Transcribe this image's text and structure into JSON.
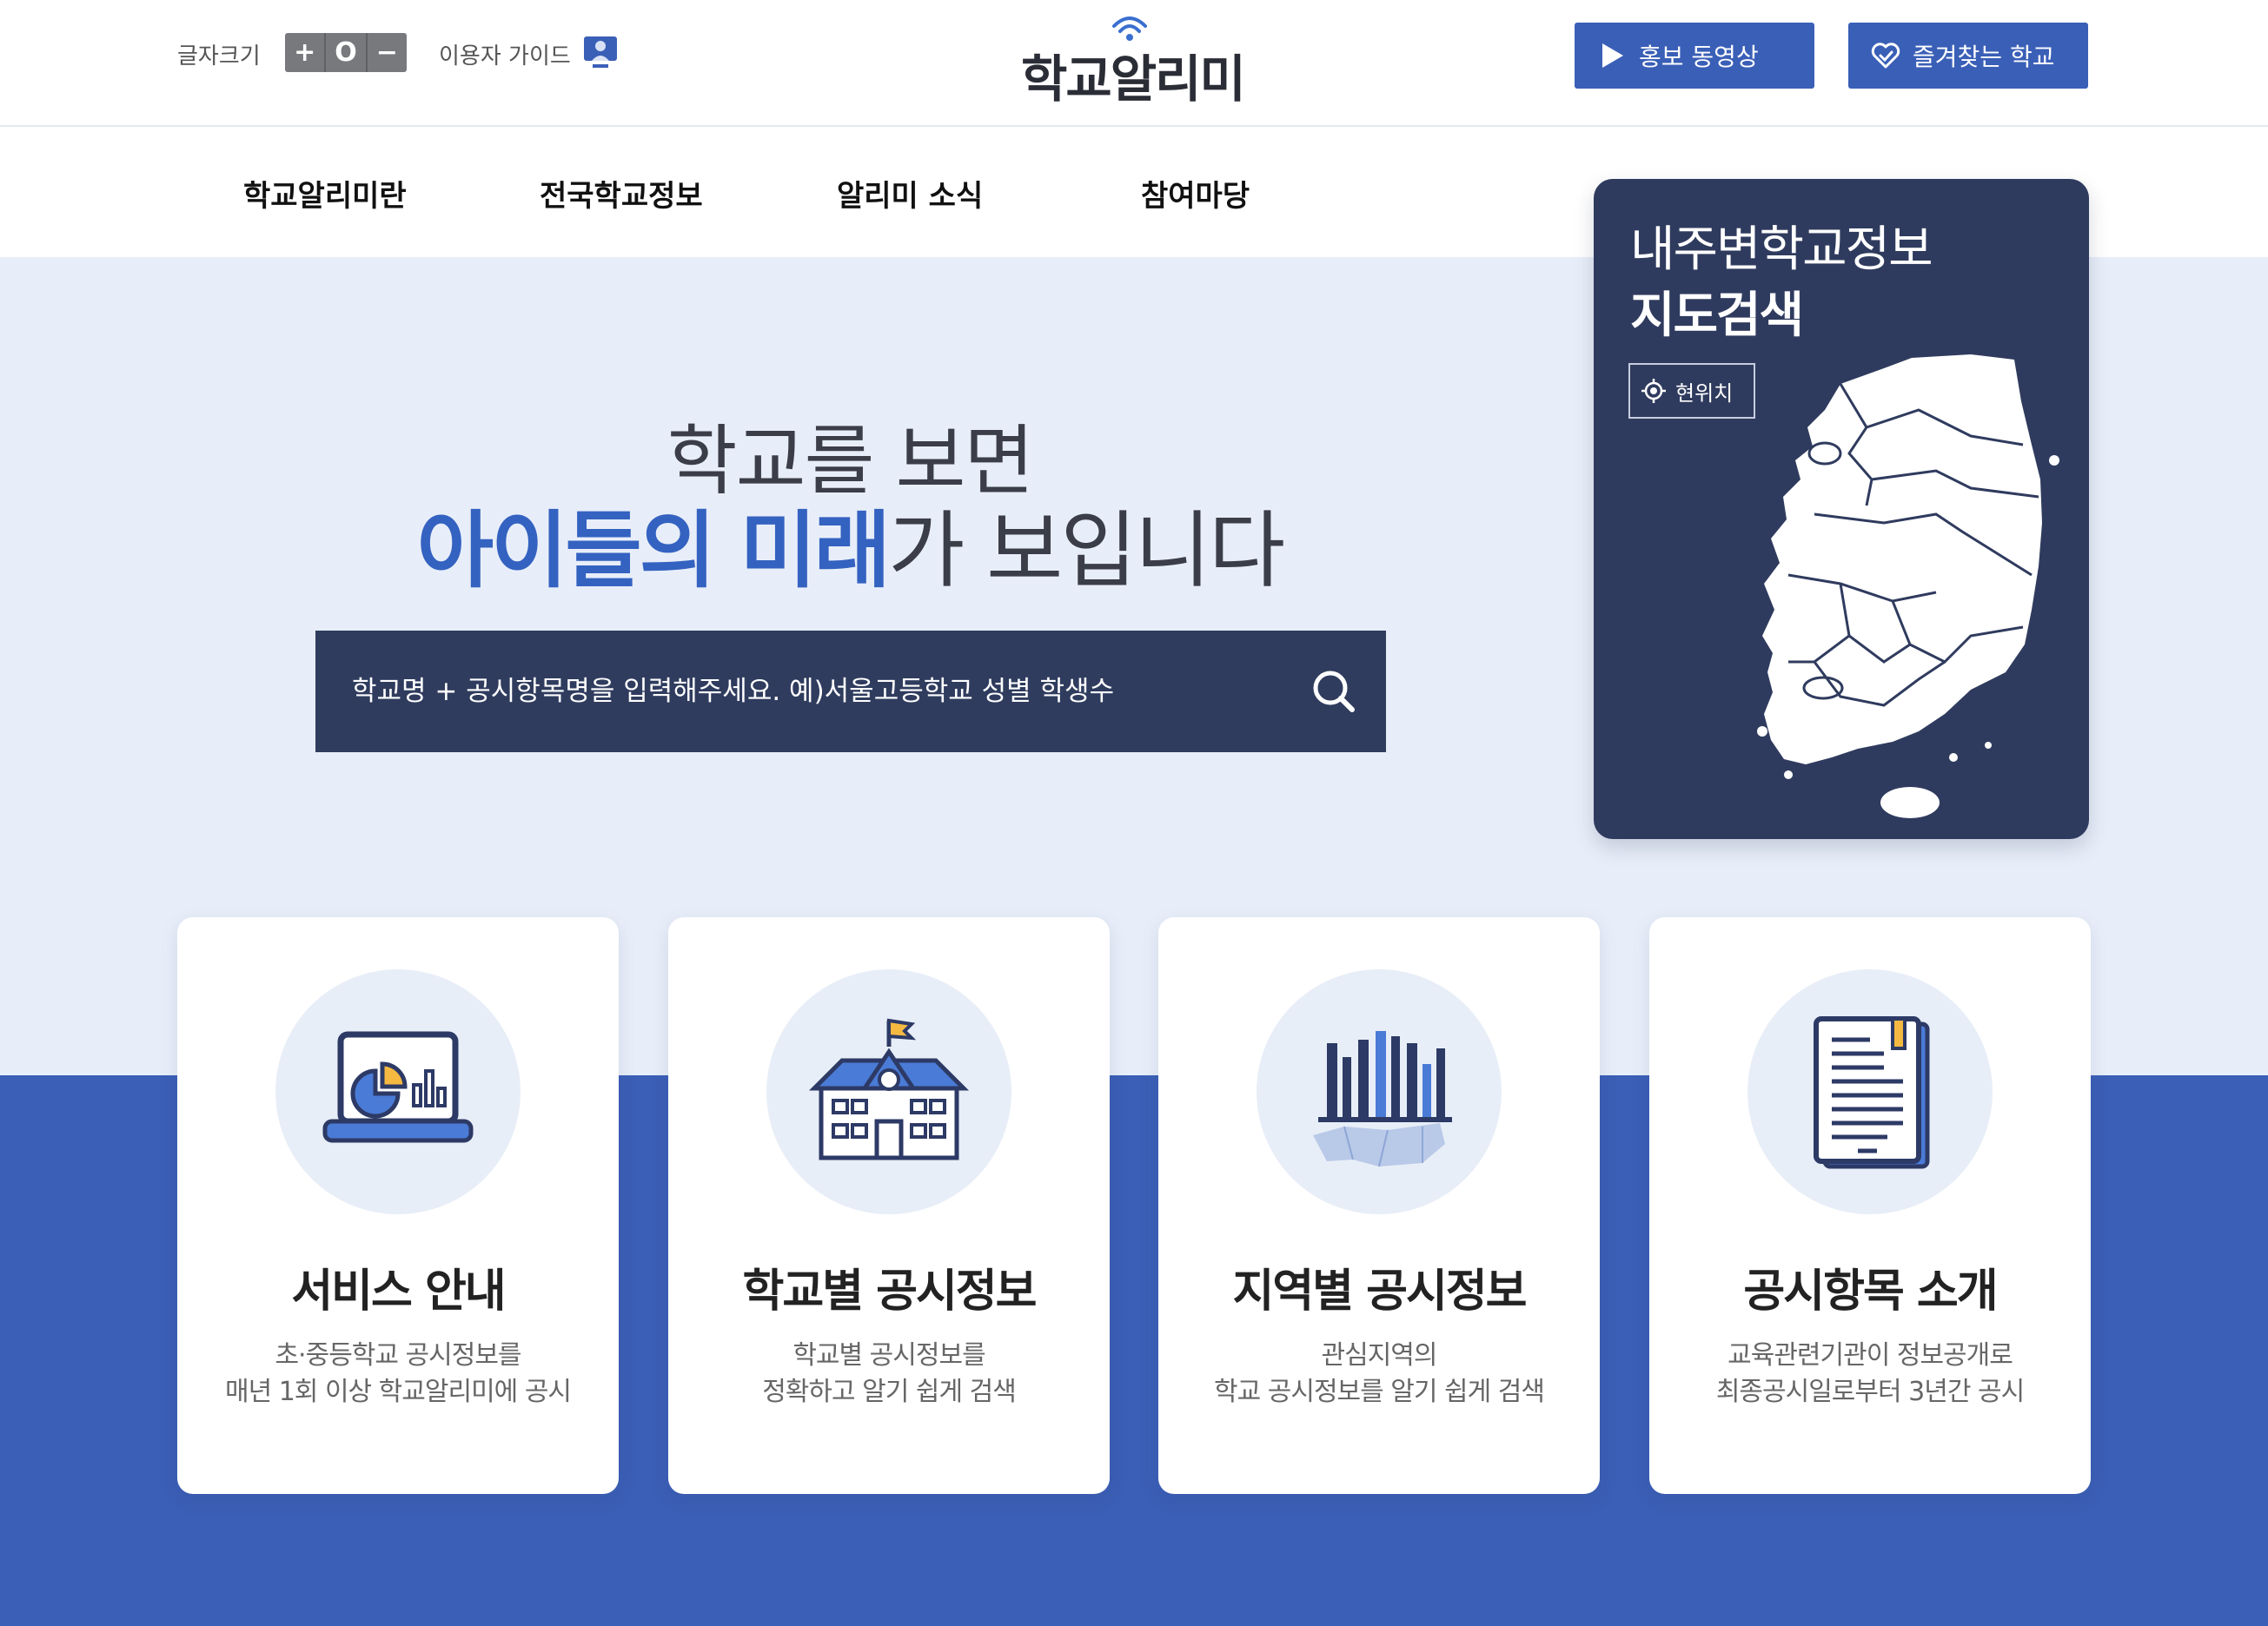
{
  "header": {
    "font_size_label": "글자크기",
    "font_size_controls": [
      "+",
      "O",
      "−"
    ],
    "guide_label": "이용자 가이드",
    "logo_text": "학교알리미",
    "promo_video_label": "홍보 동영상",
    "favorites_label": "즐겨찾는 학교"
  },
  "nav": {
    "items": [
      "학교알리미란",
      "전국학교정보",
      "알리미 소식",
      "참여마당"
    ]
  },
  "hero": {
    "line1": "학교를 보면",
    "line2_highlight": "아이들의 미래",
    "line2_rest": "가 보입니다",
    "search_placeholder": "학교명 + 공시항목명을 입력해주세요. 예)서울고등학교 성별 학생수"
  },
  "map_card": {
    "title_line1": "내주변학교정보",
    "title_line2": "지도검색",
    "location_button": "현위치"
  },
  "cards": [
    {
      "title": "서비스 안내",
      "desc_line1": "초·중등학교 공시정보를",
      "desc_line2": "매년 1회 이상 학교알리미에 공시",
      "icon": "laptop-chart-icon"
    },
    {
      "title": "학교별 공시정보",
      "desc_line1": "학교별 공시정보를",
      "desc_line2": "정확하고 알기 쉽게 검색",
      "icon": "school-building-icon"
    },
    {
      "title": "지역별 공시정보",
      "desc_line1": "관심지역의",
      "desc_line2": "학교 공시정보를 알기 쉽게 검색",
      "icon": "region-bar-chart-icon"
    },
    {
      "title": "공시항목 소개",
      "desc_line1": "교육관련기관이 정보공개로",
      "desc_line2": "최종공시일로부터 3년간 공시",
      "icon": "document-tablet-icon"
    }
  ],
  "colors": {
    "primary": "#3a5fb7",
    "navy": "#2f3b5e",
    "hero_bg": "#e8eef9",
    "accent_yellow": "#f5b942"
  }
}
